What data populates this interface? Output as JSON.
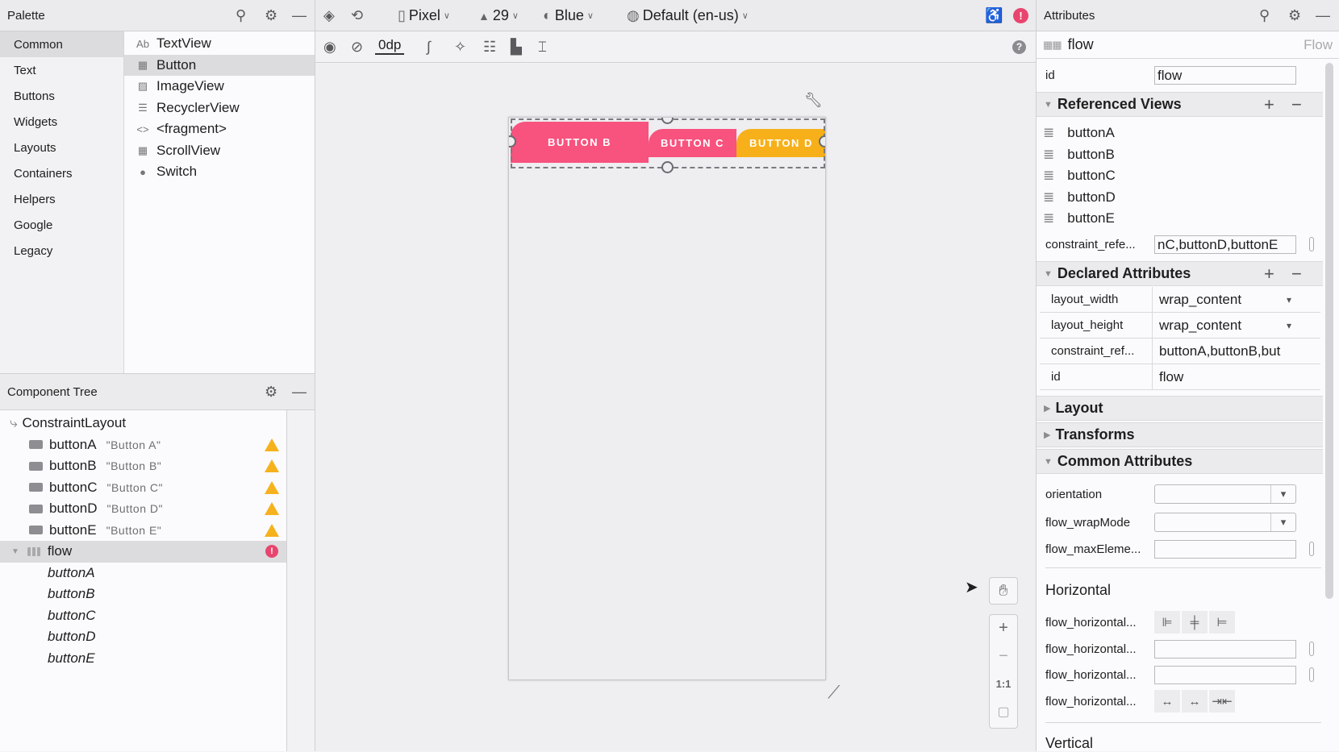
{
  "palette": {
    "title": "Palette",
    "categories": [
      "Common",
      "Text",
      "Buttons",
      "Widgets",
      "Layouts",
      "Containers",
      "Helpers",
      "Google",
      "Legacy"
    ],
    "items": [
      {
        "icon": "Ab",
        "label": "TextView"
      },
      {
        "icon": "▦",
        "label": "Button"
      },
      {
        "icon": "▨",
        "label": "ImageView"
      },
      {
        "icon": "☰",
        "label": "RecyclerView"
      },
      {
        "icon": "<>",
        "label": "<fragment>"
      },
      {
        "icon": "▦",
        "label": "ScrollView"
      },
      {
        "icon": "●",
        "label": "Switch"
      }
    ]
  },
  "tree": {
    "title": "Component Tree",
    "root": "ConstraintLayout",
    "buttons": [
      {
        "id": "buttonA",
        "text": "\"Button A\""
      },
      {
        "id": "buttonB",
        "text": "\"Button B\""
      },
      {
        "id": "buttonC",
        "text": "\"Button C\""
      },
      {
        "id": "buttonD",
        "text": "\"Button D\""
      },
      {
        "id": "buttonE",
        "text": "\"Button E\""
      }
    ],
    "flow": "flow",
    "flow_children": [
      "buttonA",
      "buttonB",
      "buttonC",
      "buttonD",
      "buttonE"
    ],
    "error_glyph": "!"
  },
  "toolbar": {
    "device": "Pixel",
    "api": "29",
    "theme": "Blue",
    "locale": "Default (en-us)",
    "margin": "0dp"
  },
  "canvas": {
    "buttons": [
      "BUTTON B",
      "BUTTON C",
      "BUTTON D"
    ],
    "colors": {
      "pink": "#f8527e",
      "orange": "#f7b01a"
    }
  },
  "zoom": {
    "plus": "+",
    "minus": "−",
    "one": "1:1"
  },
  "attributes": {
    "title": "Attributes",
    "component": "flow",
    "component_type": "Flow",
    "id_label": "id",
    "id_value": "flow",
    "referenced": {
      "title": "Referenced Views",
      "items": [
        "buttonA",
        "buttonB",
        "buttonC",
        "buttonD",
        "buttonE"
      ],
      "field_label": "constraint_refe...",
      "field_value": "nC,buttonD,buttonE"
    },
    "declared": {
      "title": "Declared Attributes",
      "rows": [
        {
          "k": "layout_width",
          "v": "wrap_content"
        },
        {
          "k": "layout_height",
          "v": "wrap_content"
        },
        {
          "k": "constraint_ref...",
          "v": "buttonA,buttonB,but"
        },
        {
          "k": "id",
          "v": "flow"
        }
      ]
    },
    "layout": "Layout",
    "transforms": "Transforms",
    "common": "Common Attributes",
    "orientation": "orientation",
    "wrapMode": "flow_wrapMode",
    "maxElem": "flow_maxEleme...",
    "horizontal": "Horizontal",
    "h1": "flow_horizontal...",
    "h2": "flow_horizontal...",
    "h3": "flow_horizontal...",
    "h4": "flow_horizontal...",
    "vertical": "Vertical"
  }
}
